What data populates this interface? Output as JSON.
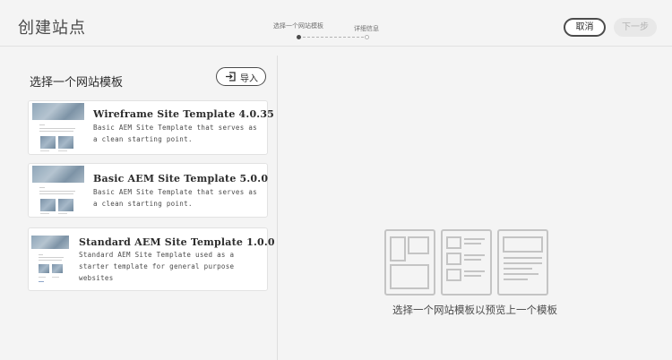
{
  "header": {
    "title": "创建站点",
    "steps": [
      {
        "label": "选择一个网站模板",
        "state": "active"
      },
      {
        "label": "详细信息",
        "state": "pending"
      }
    ],
    "cancel_label": "取消",
    "next_label": "下一步"
  },
  "templates_panel": {
    "title": "选择一个网站模板",
    "import_label": "导入",
    "import_icon": "import-icon",
    "cards": [
      {
        "title": "Wireframe Site Template 4.0.35",
        "desc_lines": [
          "Basic AEM Site Template that serves as",
          "a clean starting point."
        ]
      },
      {
        "title": "Basic AEM Site Template 5.0.0",
        "desc_lines": [
          "Basic AEM Site Template that serves as",
          "a clean starting point."
        ]
      },
      {
        "title": "Standard AEM Site Template 1.0.0",
        "desc_lines": [
          "Standard AEM Site Template used as a",
          "starter template for general purpose",
          "websites"
        ]
      }
    ]
  },
  "preview": {
    "icon": "template-layout-icon",
    "caption": "选择一个网站模板以预览上一个模板"
  }
}
